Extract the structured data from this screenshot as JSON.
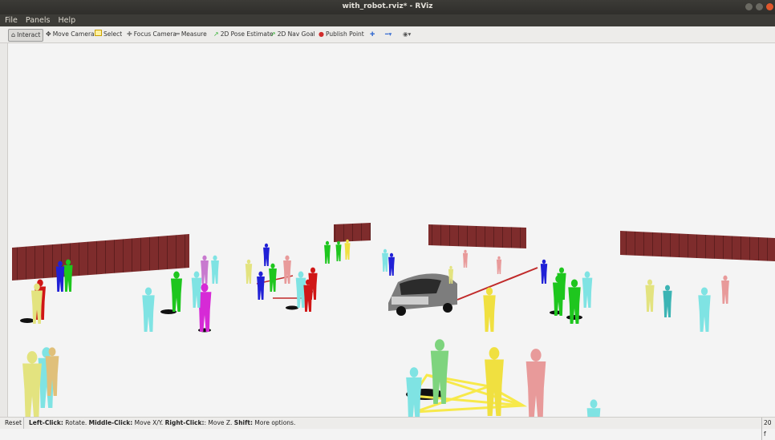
{
  "window": {
    "title": "with_robot.rviz* - RViz"
  },
  "menu": [
    "File",
    "Panels",
    "Help"
  ],
  "toolbar": {
    "interact": "Interact",
    "move_camera": "Move Camera",
    "select": "Select",
    "focus_camera": "Focus Camera",
    "measure": "Measure",
    "pose_estimate": "2D Pose Estimate",
    "nav_goal": "2D Nav Goal",
    "publish_point": "Publish Point"
  },
  "status": {
    "reset": "Reset",
    "hint_parts": [
      {
        "b": "Left-Click:",
        "t": " Rotate. "
      },
      {
        "b": "Middle-Click:",
        "t": " Move X/Y. "
      },
      {
        "b": "Right-Click:",
        "t": ": Move Z. "
      },
      {
        "b": "Shift:",
        "t": " More options."
      }
    ],
    "fps": "20 f"
  },
  "colors": {
    "wall": "#7a2a2a",
    "ground": "#f4f4f4",
    "selection_lines": "#f7e94a",
    "groups": "#c02a2a"
  },
  "people": [
    {
      "c": "#7fe3e3"
    },
    {
      "c": "#e3e37f"
    },
    {
      "c": "#e0c07a"
    },
    {
      "c": "#1ec61e"
    },
    {
      "c": "#2020d6"
    },
    {
      "c": "#d01616"
    },
    {
      "c": "#e3e37f"
    },
    {
      "c": "#7fe3e3"
    },
    {
      "c": "#d62ad6"
    },
    {
      "c": "#1ec61e"
    },
    {
      "c": "#7fe3e3"
    },
    {
      "c": "#c87acf"
    },
    {
      "c": "#d01616"
    },
    {
      "c": "#7fe3e3"
    },
    {
      "c": "#2020d6"
    },
    {
      "c": "#1ec61e"
    },
    {
      "c": "#e89a9a"
    },
    {
      "c": "#e3e37f"
    },
    {
      "c": "#7fe3e3"
    },
    {
      "c": "#2020d6"
    },
    {
      "c": "#1ec61e"
    },
    {
      "c": "#f0e040"
    },
    {
      "c": "#1ec61e"
    },
    {
      "c": "#7fe3e3"
    },
    {
      "c": "#2020d6"
    },
    {
      "c": "#e89a9a"
    },
    {
      "c": "#f0e040"
    },
    {
      "c": "#7fe3e3"
    },
    {
      "c": "#3cb4b4"
    },
    {
      "c": "#e3e37f"
    },
    {
      "c": "#e89a9a"
    },
    {
      "c": "#7ed47e"
    },
    {
      "c": "#f0e040"
    },
    {
      "c": "#1ec61e"
    },
    {
      "c": "#1ec61e"
    },
    {
      "c": "#e89a9a"
    },
    {
      "c": "#7fe3e3"
    },
    {
      "c": "#d01616"
    },
    {
      "c": "#7fe3e3"
    },
    {
      "c": "#1ec61e"
    },
    {
      "c": "#2020d6"
    },
    {
      "c": "#e3e37f"
    },
    {
      "c": "#e89a9a"
    },
    {
      "c": "#7fe3e3"
    }
  ]
}
